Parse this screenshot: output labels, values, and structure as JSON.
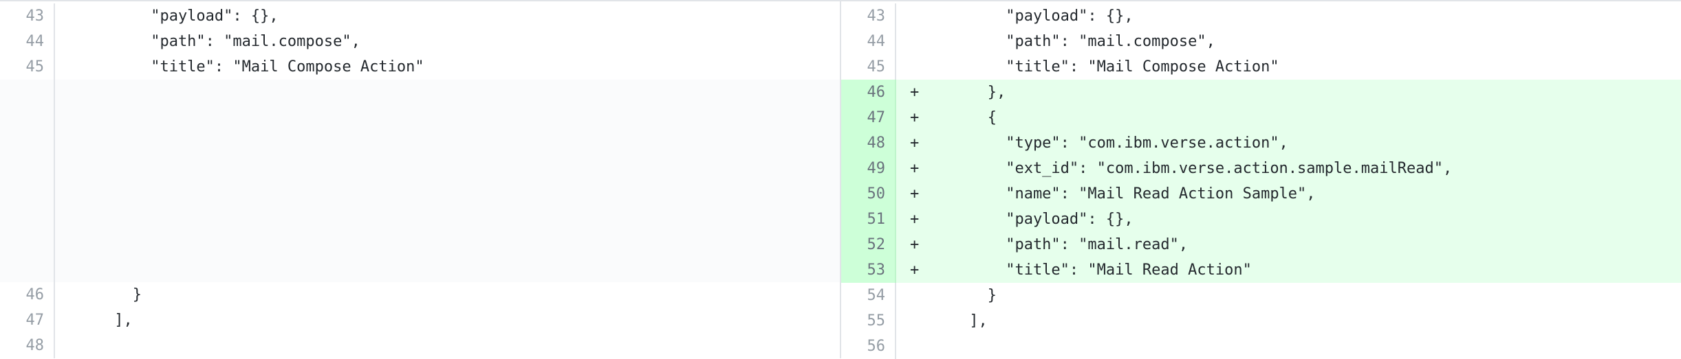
{
  "left": {
    "rows": [
      {
        "num": "43",
        "text": "         \"payload\": {},"
      },
      {
        "num": "44",
        "text": "         \"path\": \"mail.compose\","
      },
      {
        "num": "45",
        "text": "         \"title\": \"Mail Compose Action\""
      },
      {
        "num": "",
        "text": ""
      },
      {
        "num": "",
        "text": ""
      },
      {
        "num": "",
        "text": ""
      },
      {
        "num": "",
        "text": ""
      },
      {
        "num": "",
        "text": ""
      },
      {
        "num": "",
        "text": ""
      },
      {
        "num": "",
        "text": ""
      },
      {
        "num": "",
        "text": ""
      },
      {
        "num": "46",
        "text": "       }"
      },
      {
        "num": "47",
        "text": "     ],"
      },
      {
        "num": "48",
        "text": ""
      }
    ]
  },
  "right": {
    "rows": [
      {
        "num": "43",
        "marker": "",
        "text": "         \"payload\": {},"
      },
      {
        "num": "44",
        "marker": "",
        "text": "         \"path\": \"mail.compose\","
      },
      {
        "num": "45",
        "marker": "",
        "text": "         \"title\": \"Mail Compose Action\""
      },
      {
        "num": "46",
        "marker": "+",
        "text": "       },"
      },
      {
        "num": "47",
        "marker": "+",
        "text": "       {"
      },
      {
        "num": "48",
        "marker": "+",
        "text": "         \"type\": \"com.ibm.verse.action\","
      },
      {
        "num": "49",
        "marker": "+",
        "text": "         \"ext_id\": \"com.ibm.verse.action.sample.mailRead\","
      },
      {
        "num": "50",
        "marker": "+",
        "text": "         \"name\": \"Mail Read Action Sample\","
      },
      {
        "num": "51",
        "marker": "+",
        "text": "         \"payload\": {},"
      },
      {
        "num": "52",
        "marker": "+",
        "text": "         \"path\": \"mail.read\","
      },
      {
        "num": "53",
        "marker": "+",
        "text": "         \"title\": \"Mail Read Action\""
      },
      {
        "num": "54",
        "marker": "",
        "text": "       }"
      },
      {
        "num": "55",
        "marker": "",
        "text": "     ],"
      },
      {
        "num": "56",
        "marker": "",
        "text": ""
      }
    ]
  },
  "colors": {
    "added_bg": "#e6ffec",
    "added_gutter": "#cdffd8",
    "empty_bg": "#fafbfc",
    "line_number": "#959da5"
  }
}
